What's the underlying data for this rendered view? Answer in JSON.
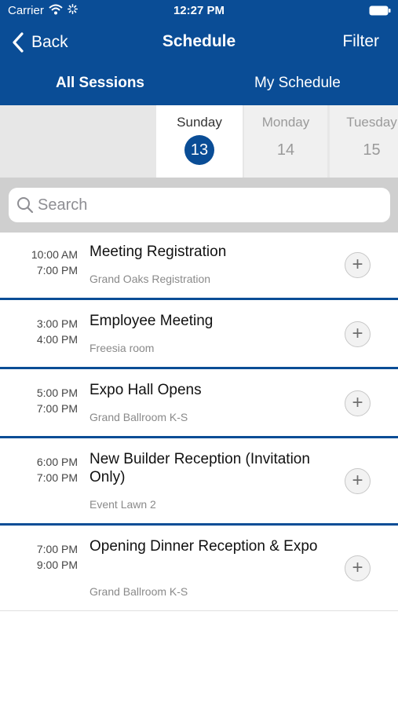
{
  "status_bar": {
    "carrier": "Carrier",
    "time": "12:27 PM"
  },
  "nav": {
    "back_label": "Back",
    "title": "Schedule",
    "filter_label": "Filter"
  },
  "tabs": [
    {
      "label": "All Sessions",
      "selected": true
    },
    {
      "label": "My Schedule",
      "selected": false
    }
  ],
  "dates": [
    {
      "day": "Sunday",
      "num": "13",
      "selected": true
    },
    {
      "day": "Monday",
      "num": "14",
      "selected": false
    },
    {
      "day": "Tuesday",
      "num": "15",
      "selected": false
    }
  ],
  "search": {
    "placeholder": "Search",
    "value": ""
  },
  "sessions": [
    {
      "start": "10:00 AM",
      "end": "7:00 PM",
      "title": "Meeting Registration",
      "location": "Grand Oaks Registration",
      "add_symbol": "+"
    },
    {
      "start": "3:00 PM",
      "end": "4:00 PM",
      "title": "Employee Meeting",
      "location": "Freesia room",
      "add_symbol": "+"
    },
    {
      "start": "5:00 PM",
      "end": "7:00 PM",
      "title": "Expo Hall Opens",
      "location": "Grand Ballroom K-S",
      "add_symbol": "+"
    },
    {
      "start": "6:00 PM",
      "end": "7:00 PM",
      "title": "New Builder Reception (Invitation Only)",
      "location": "Event Lawn 2",
      "add_symbol": "+"
    },
    {
      "start": "7:00 PM",
      "end": "9:00 PM",
      "title": "Opening Dinner Reception & Expo",
      "location": "Grand Ballroom K-S",
      "add_symbol": "+"
    }
  ],
  "colors": {
    "brand": "#0a4d96",
    "date_strip": "#e7e7e7",
    "search_area": "#cfcfcf"
  }
}
